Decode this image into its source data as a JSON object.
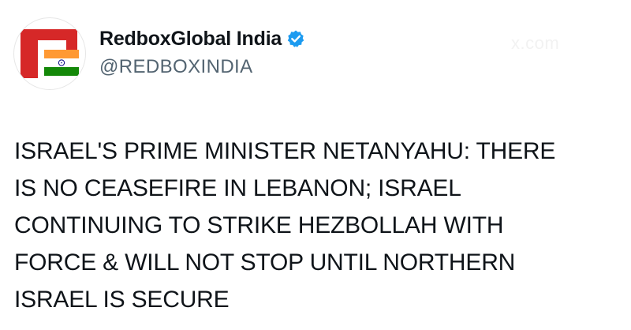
{
  "tweet": {
    "author": {
      "display_name": "RedboxGlobal India",
      "handle": "@REDBOXINDIA",
      "verified": true,
      "avatar_icon": "redbox-india-logo-icon",
      "verified_icon": "verified-badge-icon"
    },
    "watermark": "x.com",
    "text_lines": [
      "ISRAEL'S PRIME MINISTER NETANYAHU: THERE",
      "IS NO CEASEFIRE IN LEBANON; ISRAEL",
      "CONTINUING TO STRIKE HEZBOLLAH WITH",
      "FORCE & WILL NOT STOP UNTIL NORTHERN",
      "ISRAEL IS SECURE"
    ],
    "text": "ISRAEL'S PRIME MINISTER NETANYAHU: THERE\nIS NO CEASEFIRE IN LEBANON; ISRAEL\nCONTINUING TO STRIKE HEZBOLLAH WITH\nFORCE & WILL NOT STOP UNTIL NORTHERN\nISRAEL IS SECURE"
  },
  "colors": {
    "brand_red": "#d62828",
    "saffron": "#ff9933",
    "india_green": "#138808",
    "chakra_blue": "#000080",
    "verified_blue": "#1d9bf0",
    "text_primary": "#0f1419",
    "text_secondary": "#536471"
  }
}
